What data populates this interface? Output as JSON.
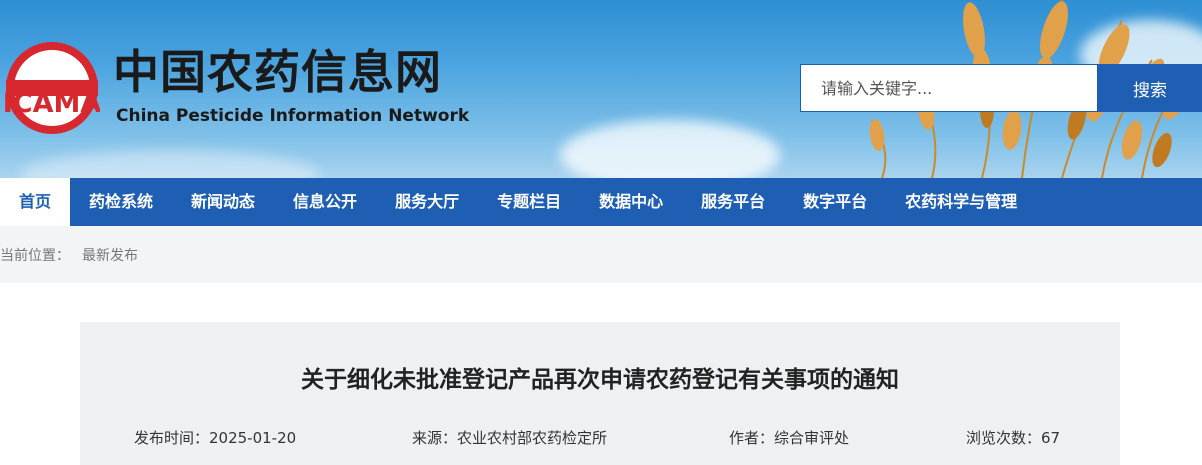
{
  "header": {
    "logo_text": "ICAMA",
    "site_name_cn": "中国农药信息网",
    "site_name_en": "China Pesticide Information Network"
  },
  "search": {
    "placeholder": "请输入关键字...",
    "button_label": "搜索"
  },
  "nav": {
    "items": [
      {
        "label": "首页"
      },
      {
        "label": "药检系统"
      },
      {
        "label": "新闻动态"
      },
      {
        "label": "信息公开"
      },
      {
        "label": "服务大厅"
      },
      {
        "label": "专题栏目"
      },
      {
        "label": "数据中心"
      },
      {
        "label": "服务平台"
      },
      {
        "label": "数字平台"
      },
      {
        "label": "农药科学与管理"
      }
    ]
  },
  "breadcrumb": {
    "label": "当前位置：",
    "current": "最新发布"
  },
  "article": {
    "title": "关于细化未批准登记产品再次申请农药登记有关事项的通知",
    "publish_time": "发布时间：2025-01-20",
    "source": "来源：农业农村部农药检定所",
    "author": "作者：综合审评处",
    "views": "浏览次数：67"
  },
  "colors": {
    "primary": "#1f5fb3",
    "logo_red": "#d7282f",
    "breadcrumb_bg": "#f3f4f6",
    "article_bg": "#eef0f4"
  }
}
